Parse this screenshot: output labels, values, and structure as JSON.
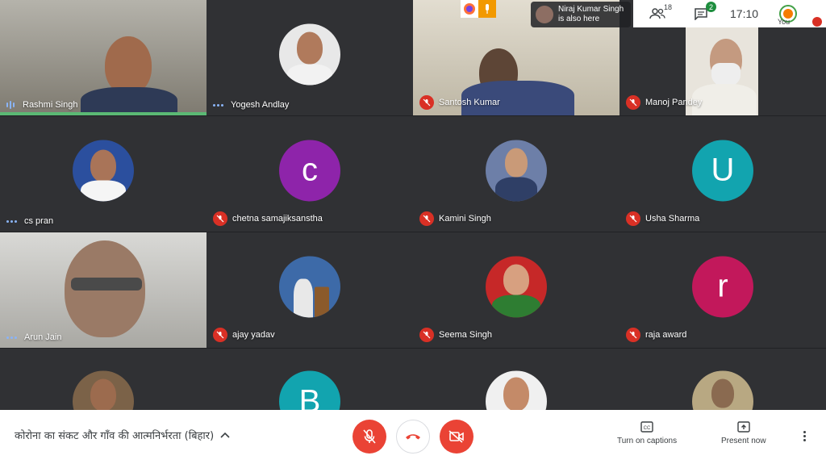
{
  "participants": [
    {
      "name": "Rashmi Singh",
      "status": "speaking"
    },
    {
      "name": "Yogesh Andlay",
      "status": "active"
    },
    {
      "name": "Santosh Kumar",
      "status": "muted"
    },
    {
      "name": "Manoj Pandey",
      "status": "muted"
    },
    {
      "name": "cs pran",
      "status": "active"
    },
    {
      "name": "chetna samajiksanstha",
      "status": "muted",
      "initial": "c",
      "color": "#8e24aa"
    },
    {
      "name": "Kamini Singh",
      "status": "muted"
    },
    {
      "name": "Usha Sharma",
      "status": "muted",
      "initial": "U",
      "color": "#12a4af"
    },
    {
      "name": "Arun Jain",
      "status": "active"
    },
    {
      "name": "ajay yadav",
      "status": "muted"
    },
    {
      "name": "Seema Singh",
      "status": "muted"
    },
    {
      "name": "raja award",
      "status": "muted",
      "initial": "r",
      "color": "#c2185b"
    },
    {
      "name": "",
      "status": "video"
    },
    {
      "name": "",
      "status": "video",
      "initial": "B",
      "color": "#12a4af"
    },
    {
      "name": "",
      "status": "video"
    },
    {
      "name": "",
      "status": "video"
    }
  ],
  "top": {
    "also_here_line1": "Niraj Kumar Singh",
    "also_here_line2": "is also here",
    "people_count": "18",
    "chat_count": "2",
    "time": "17:10",
    "you_label": "You"
  },
  "bottom": {
    "meeting_title": "कोरोना का संकट और गाँव की आत्मनिर्भरता (बिहार)",
    "captions_label": "Turn on captions",
    "present_label": "Present now"
  },
  "colors": {
    "accent_green": "#5bb974",
    "mute_red": "#d93025",
    "control_red": "#ea4335"
  }
}
